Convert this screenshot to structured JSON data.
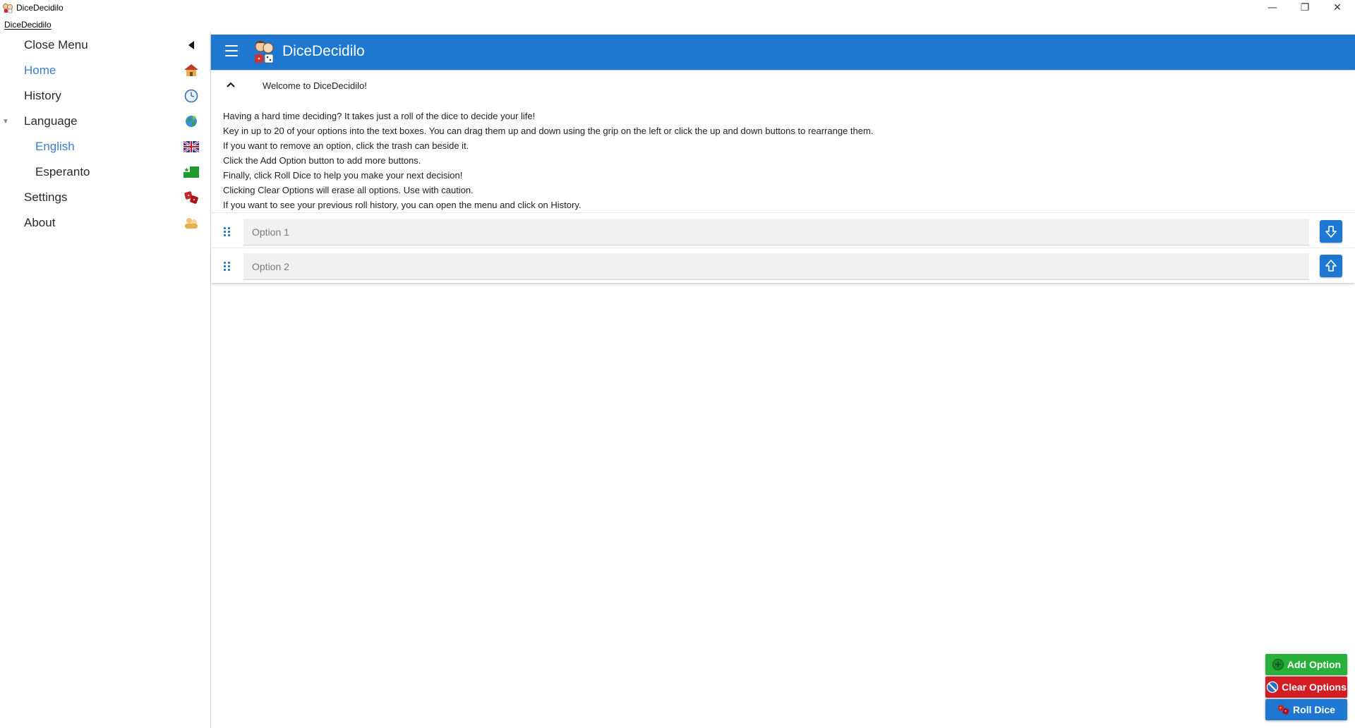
{
  "window": {
    "title": "DiceDecidilo",
    "menu_strip_label": "DiceDecidilo",
    "minimize_glyph": "—",
    "maximize_glyph": "❐",
    "close_glyph": "✕"
  },
  "sidebar": {
    "items": [
      {
        "label": "Close Menu",
        "icon": "caret-left-icon"
      },
      {
        "label": "Home",
        "icon": "home-icon",
        "active": true
      },
      {
        "label": "History",
        "icon": "clock-icon"
      },
      {
        "label": "Language",
        "icon": "globe-icon",
        "expanded": true
      },
      {
        "label": "English",
        "icon": "uk-flag-icon",
        "sub": true
      },
      {
        "label": "Esperanto",
        "icon": "esperanto-flag-icon",
        "sub": true
      },
      {
        "label": "Settings",
        "icon": "dice-icon"
      },
      {
        "label": "About",
        "icon": "info-icon"
      }
    ]
  },
  "appbar": {
    "title": "DiceDecidilo"
  },
  "welcome": {
    "title": "Welcome to DiceDecidilo!",
    "lines": [
      "Having a hard time deciding? It takes just a roll of the dice to decide your life!",
      "Key in up to 20 of your options into the text boxes. You can drag them up and down using the grip on the left or click the up and down buttons to rearrange them.",
      "If you want to remove an option, click the trash can beside it.",
      "Click the Add Option button to add more buttons.",
      "Finally, click Roll Dice to help you make your next decision!",
      "Clicking Clear Options will erase all options. Use with caution.",
      "If you want to see your previous roll history, you can open the menu and click on History."
    ]
  },
  "options": [
    {
      "placeholder": "Option 1",
      "value": "",
      "move": "down"
    },
    {
      "placeholder": "Option 2",
      "value": "",
      "move": "up"
    }
  ],
  "actions": {
    "add_label": "Add Option",
    "clear_label": "Clear Options",
    "roll_label": "Roll Dice"
  },
  "colors": {
    "primary": "#1e78d2",
    "add": "#27b03a",
    "clear": "#d21d25",
    "active_link": "#3b7dd0"
  }
}
